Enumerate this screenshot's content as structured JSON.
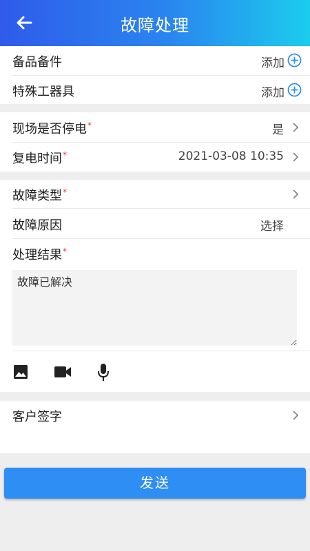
{
  "header": {
    "title": "故障处理",
    "back_icon": "arrow-left-icon"
  },
  "parts": {
    "spare_parts": {
      "label": "备品备件",
      "action": "添加"
    },
    "special_tools": {
      "label": "特殊工器具",
      "action": "添加"
    }
  },
  "power": {
    "power_off": {
      "label": "现场是否停电",
      "required_mark": "*",
      "value": "是"
    },
    "restore_time": {
      "label": "复电时间",
      "required_mark": "*",
      "value": "2021-03-08 10:35"
    }
  },
  "fault": {
    "type": {
      "label": "故障类型",
      "required_mark": "*",
      "value": ""
    },
    "cause": {
      "label": "故障原因",
      "value": "选择"
    },
    "result": {
      "label": "处理结果",
      "required_mark": "*",
      "text": "故障已解决"
    }
  },
  "media": {
    "icons": [
      "image-icon",
      "video-camera-icon",
      "microphone-icon"
    ]
  },
  "signature": {
    "label": "客户签字"
  },
  "send_button": {
    "label": "发送"
  },
  "colors": {
    "header_start": "#2f5bea",
    "header_end": "#1ccdee",
    "accent": "#2f8ef4",
    "required": "#e53935"
  }
}
